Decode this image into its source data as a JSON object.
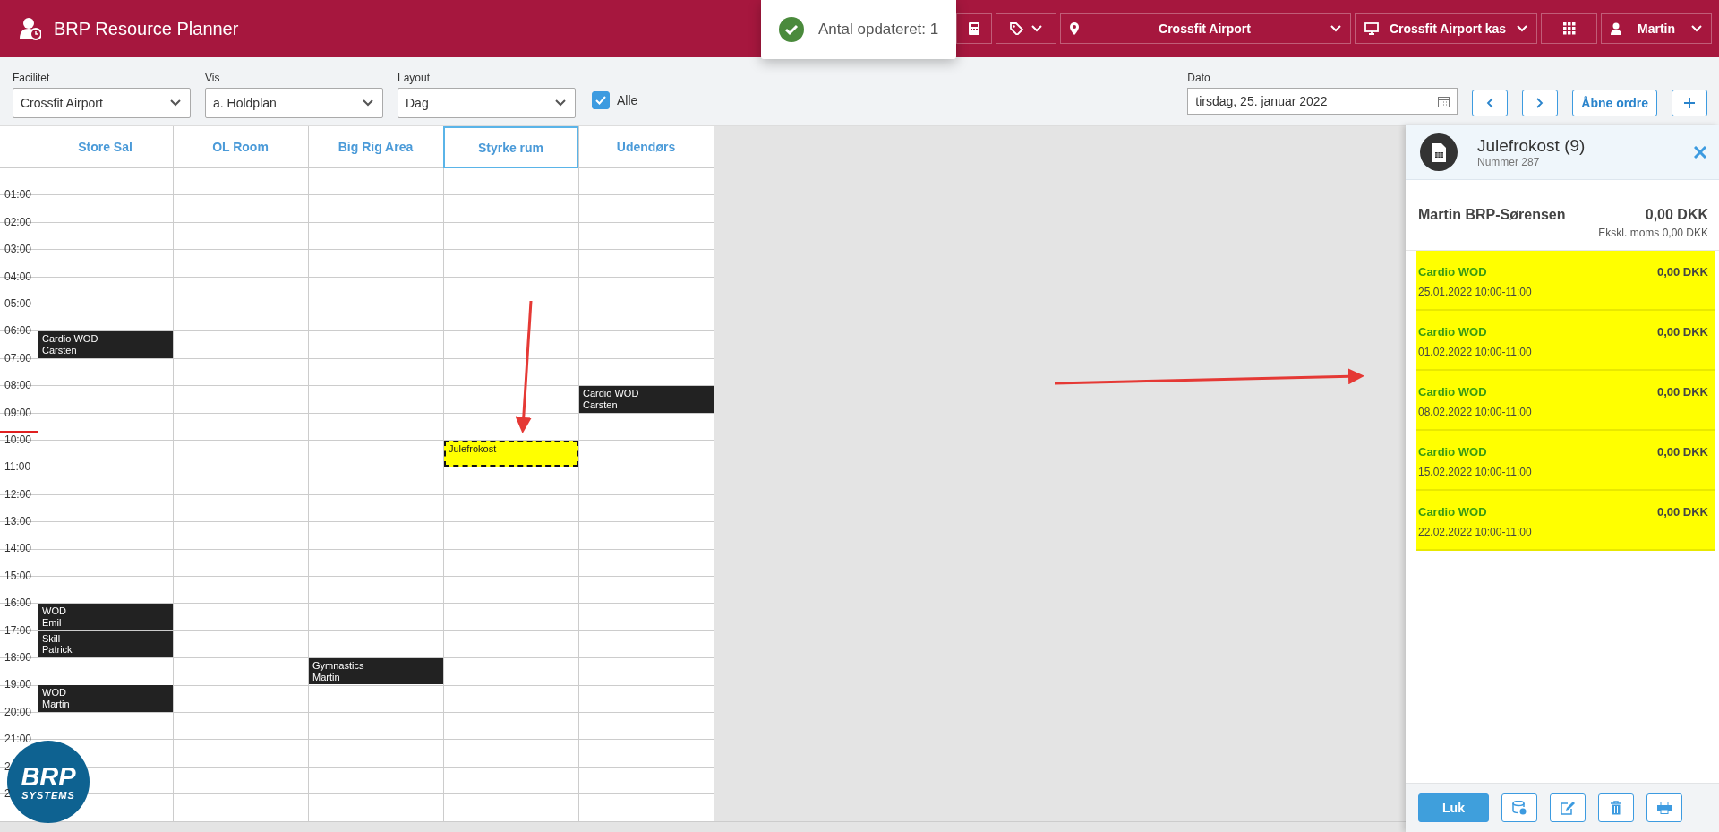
{
  "app": {
    "title": "BRP Resource Planner"
  },
  "toast": {
    "message": "Antal opdateret: 1"
  },
  "header_buttons": [
    {
      "kind": "calculator",
      "caret": false
    },
    {
      "kind": "tags",
      "caret": true
    },
    {
      "kind": "location",
      "label": "Crossfit Airport",
      "caret": true
    },
    {
      "kind": "register",
      "label": "Crossfit Airport kas",
      "caret": true
    },
    {
      "kind": "apps",
      "caret": false
    },
    {
      "kind": "user",
      "label": "Martin",
      "caret": true
    }
  ],
  "filters": [
    {
      "label": "Facilitet",
      "value": "Crossfit Airport"
    },
    {
      "label": "Vis",
      "value": "a. Holdplan"
    },
    {
      "label": "Layout",
      "value": "Dag"
    }
  ],
  "all_checkbox": {
    "label": "Alle",
    "checked": true
  },
  "date": {
    "label": "Dato",
    "value": "tirsdag, 25. januar 2022"
  },
  "nav_buttons": [
    {
      "kind": "prev"
    },
    {
      "kind": "next"
    },
    {
      "kind": "text",
      "label": "Åbne ordre"
    },
    {
      "kind": "add"
    }
  ],
  "calendar": {
    "columns": [
      {
        "name": "Store Sal",
        "selected": false
      },
      {
        "name": "OL Room",
        "selected": false
      },
      {
        "name": "Big Rig Area",
        "selected": false
      },
      {
        "name": "Styrke rum",
        "selected": true
      },
      {
        "name": "Udendørs",
        "selected": false
      }
    ],
    "rows": [
      {},
      {
        "time": "01:00"
      },
      {
        "time": "02:00"
      },
      {
        "time": "03:00"
      },
      {
        "time": "04:00"
      },
      {
        "time": "05:00"
      },
      {
        "time": "06:00",
        "cells": [
          {
            "kind": "class",
            "title": "Cardio WOD",
            "instructor": "Carsten"
          },
          {
            "kind": "empty"
          },
          {
            "kind": "empty"
          },
          {
            "kind": "empty"
          },
          {
            "kind": "empty"
          }
        ]
      },
      {
        "time": "07:00"
      },
      {
        "time": "08:00",
        "cells": [
          {
            "kind": "empty"
          },
          {
            "kind": "empty"
          },
          {
            "kind": "empty"
          },
          {
            "kind": "empty"
          },
          {
            "kind": "class",
            "title": "Cardio WOD",
            "instructor": "Carsten"
          }
        ]
      },
      {
        "time": "09:00",
        "now": true
      },
      {
        "time": "10:00",
        "cells": [
          {
            "kind": "empty"
          },
          {
            "kind": "empty"
          },
          {
            "kind": "empty"
          },
          {
            "kind": "booking",
            "title": "Julefrokost"
          },
          {
            "kind": "empty"
          }
        ]
      },
      {
        "time": "11:00"
      },
      {
        "time": "12:00"
      },
      {
        "time": "13:00"
      },
      {
        "time": "14:00"
      },
      {
        "time": "15:00"
      },
      {
        "time": "16:00",
        "cells": [
          {
            "kind": "class",
            "title": "WOD",
            "instructor": "Emil"
          },
          {
            "kind": "empty"
          },
          {
            "kind": "empty"
          },
          {
            "kind": "empty"
          },
          {
            "kind": "empty"
          }
        ]
      },
      {
        "time": "17:00",
        "cells": [
          {
            "kind": "class",
            "title": "Skill",
            "instructor": "Patrick"
          },
          {
            "kind": "empty"
          },
          {
            "kind": "empty"
          },
          {
            "kind": "empty"
          },
          {
            "kind": "empty"
          }
        ]
      },
      {
        "time": "18:00",
        "cells": [
          {
            "kind": "empty"
          },
          {
            "kind": "empty"
          },
          {
            "kind": "class",
            "title": "Gymnastics",
            "instructor": "Martin"
          },
          {
            "kind": "empty"
          },
          {
            "kind": "empty"
          }
        ]
      },
      {
        "time": "19:00",
        "cells": [
          {
            "kind": "class",
            "title": "WOD",
            "instructor": "Martin"
          },
          {
            "kind": "empty"
          },
          {
            "kind": "empty"
          },
          {
            "kind": "empty"
          },
          {
            "kind": "empty"
          }
        ]
      },
      {
        "time": "20:00"
      },
      {
        "time": "21:00"
      },
      {
        "time": "2"
      },
      {
        "time": "2"
      }
    ]
  },
  "logo": {
    "line1": "BRP",
    "line2": "SYSTEMS"
  },
  "order_panel": {
    "title": "Julefrokost (9)",
    "subtitle": "Nummer 287",
    "customer": "Martin BRP-Sørensen",
    "total": "0,00 DKK",
    "excl_vat": "Ekskl. moms 0,00 DKK",
    "lines": [
      {
        "title": "Cardio WOD",
        "date": "25.01.2022 10:00-11:00",
        "price": "0,00 DKK",
        "highlighted": true
      },
      {
        "title": "Cardio WOD",
        "date": "01.02.2022 10:00-11:00",
        "price": "0,00 DKK",
        "highlighted": true
      },
      {
        "title": "Cardio WOD",
        "date": "08.02.2022 10:00-11:00",
        "price": "0,00 DKK",
        "highlighted": true
      },
      {
        "title": "Cardio WOD",
        "date": "15.02.2022 10:00-11:00",
        "price": "0,00 DKK",
        "highlighted": true
      },
      {
        "title": "Cardio WOD",
        "date": "22.02.2022 10:00-11:00",
        "price": "0,00 DKK",
        "highlighted": true
      }
    ],
    "footer_buttons": [
      {
        "kind": "text",
        "label": "Luk"
      },
      {
        "kind": "invoice"
      },
      {
        "kind": "edit"
      },
      {
        "kind": "delete"
      },
      {
        "kind": "print"
      }
    ]
  }
}
